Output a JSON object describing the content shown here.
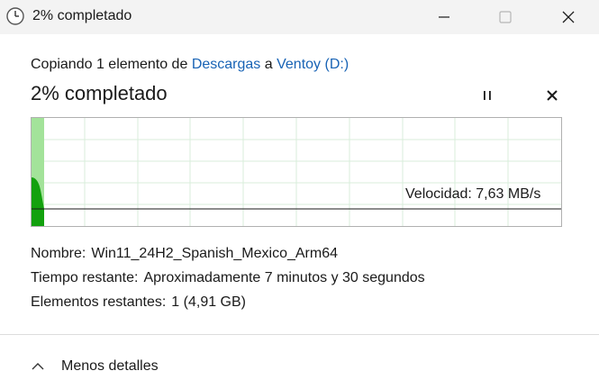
{
  "window": {
    "title": "2% completado",
    "icon": "clock-icon",
    "controls": {
      "minimize": "minimize-icon",
      "maximize": "maximize-icon",
      "close": "close-icon"
    }
  },
  "copy": {
    "prefix": "Copiando 1 elemento de",
    "source": "Descargas",
    "connector": "a",
    "destination": "Ventoy (D:)"
  },
  "status": {
    "percent_text": "2% completado",
    "progress_fraction": 0.02,
    "pause_icon": "pause-icon",
    "cancel_icon": "cancel-icon"
  },
  "graph": {
    "speed_text": "Velocidad: 7,63 MB/s",
    "progress_color": "#a3e39a",
    "speed_color": "#13a10e"
  },
  "details": {
    "name_label": "Nombre:",
    "name_value": "Win11_24H2_Spanish_Mexico_Arm64",
    "time_label": "Tiempo restante:",
    "time_value": "Aproximadamente 7 minutos y 30 segundos",
    "items_label": "Elementos restantes:",
    "items_value": "1 (4,91 GB)"
  },
  "footer": {
    "toggle_label": "Menos detalles",
    "toggle_icon": "chevron-up-icon"
  }
}
